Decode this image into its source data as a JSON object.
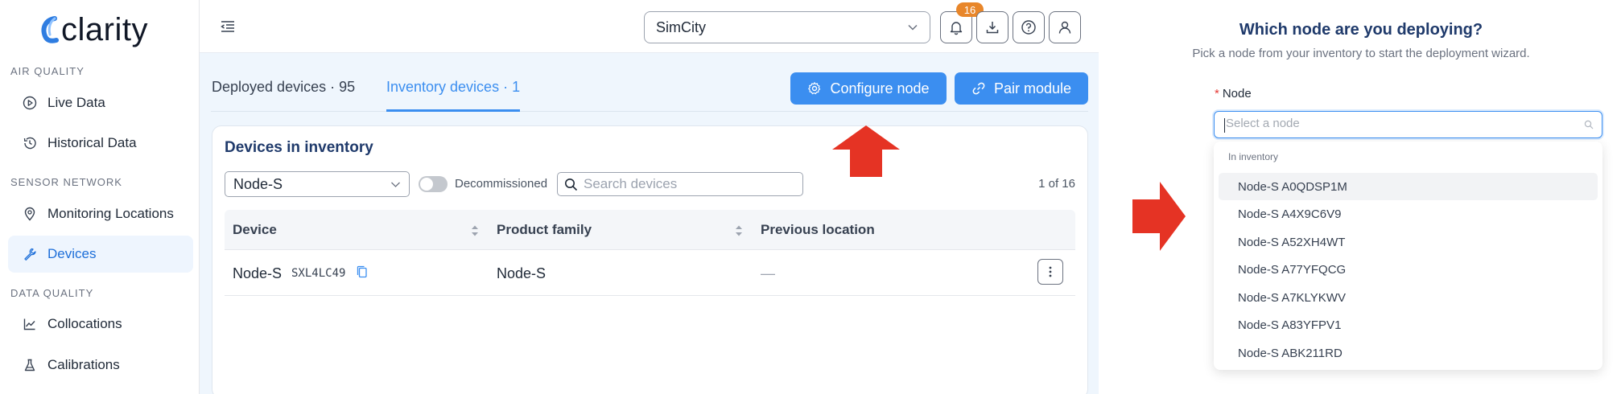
{
  "app": {
    "name": "clarity"
  },
  "sidebar": {
    "sections": [
      {
        "label": "AIR QUALITY",
        "items": [
          {
            "label": "Live Data",
            "icon": "play-circle-icon"
          },
          {
            "label": "Historical Data",
            "icon": "history-icon"
          }
        ]
      },
      {
        "label": "SENSOR NETWORK",
        "items": [
          {
            "label": "Monitoring Locations",
            "icon": "location-pin-icon"
          },
          {
            "label": "Devices",
            "icon": "wrench-icon",
            "active": true
          }
        ]
      },
      {
        "label": "DATA QUALITY",
        "items": [
          {
            "label": "Collocations",
            "icon": "line-chart-icon"
          },
          {
            "label": "Calibrations",
            "icon": "flask-icon"
          }
        ]
      }
    ]
  },
  "topbar": {
    "org_select": "SimCity",
    "notifications_count": "16"
  },
  "tabs": [
    {
      "label": "Deployed devices · 95"
    },
    {
      "label": "Inventory devices · 1",
      "active": true
    }
  ],
  "actions": {
    "configure_node": "Configure node",
    "pair_module": "Pair module"
  },
  "inventory": {
    "title": "Devices in inventory",
    "filter_value": "Node-S",
    "toggle_label": "Decommissioned",
    "search_placeholder": "Search devices",
    "pager": "1 of 16",
    "columns": [
      "Device",
      "Product family",
      "Previous location"
    ],
    "rows": [
      {
        "device": "Node-S",
        "serial": "SXL4LC49",
        "product_family": "Node-S",
        "previous_location": "—"
      }
    ]
  },
  "wizard": {
    "title": "Which node are you deploying?",
    "subtitle": "Pick a node from your inventory to start the deployment wizard.",
    "field_label": "Node",
    "required_mark": "*",
    "placeholder": "Select a node",
    "group_label": "In inventory",
    "options": [
      "Node-S A0QDSP1M",
      "Node-S A4X9C6V9",
      "Node-S A52XH4WT",
      "Node-S A77YFQCG",
      "Node-S A7KLYKWV",
      "Node-S A83YFPV1",
      "Node-S ABK211RD"
    ]
  },
  "colors": {
    "accent": "#3b8ef0",
    "active_nav_bg": "#eef5fe",
    "badge": "#e8862a",
    "annotation_arrow": "#e53324",
    "heading": "#1f3a6b"
  }
}
